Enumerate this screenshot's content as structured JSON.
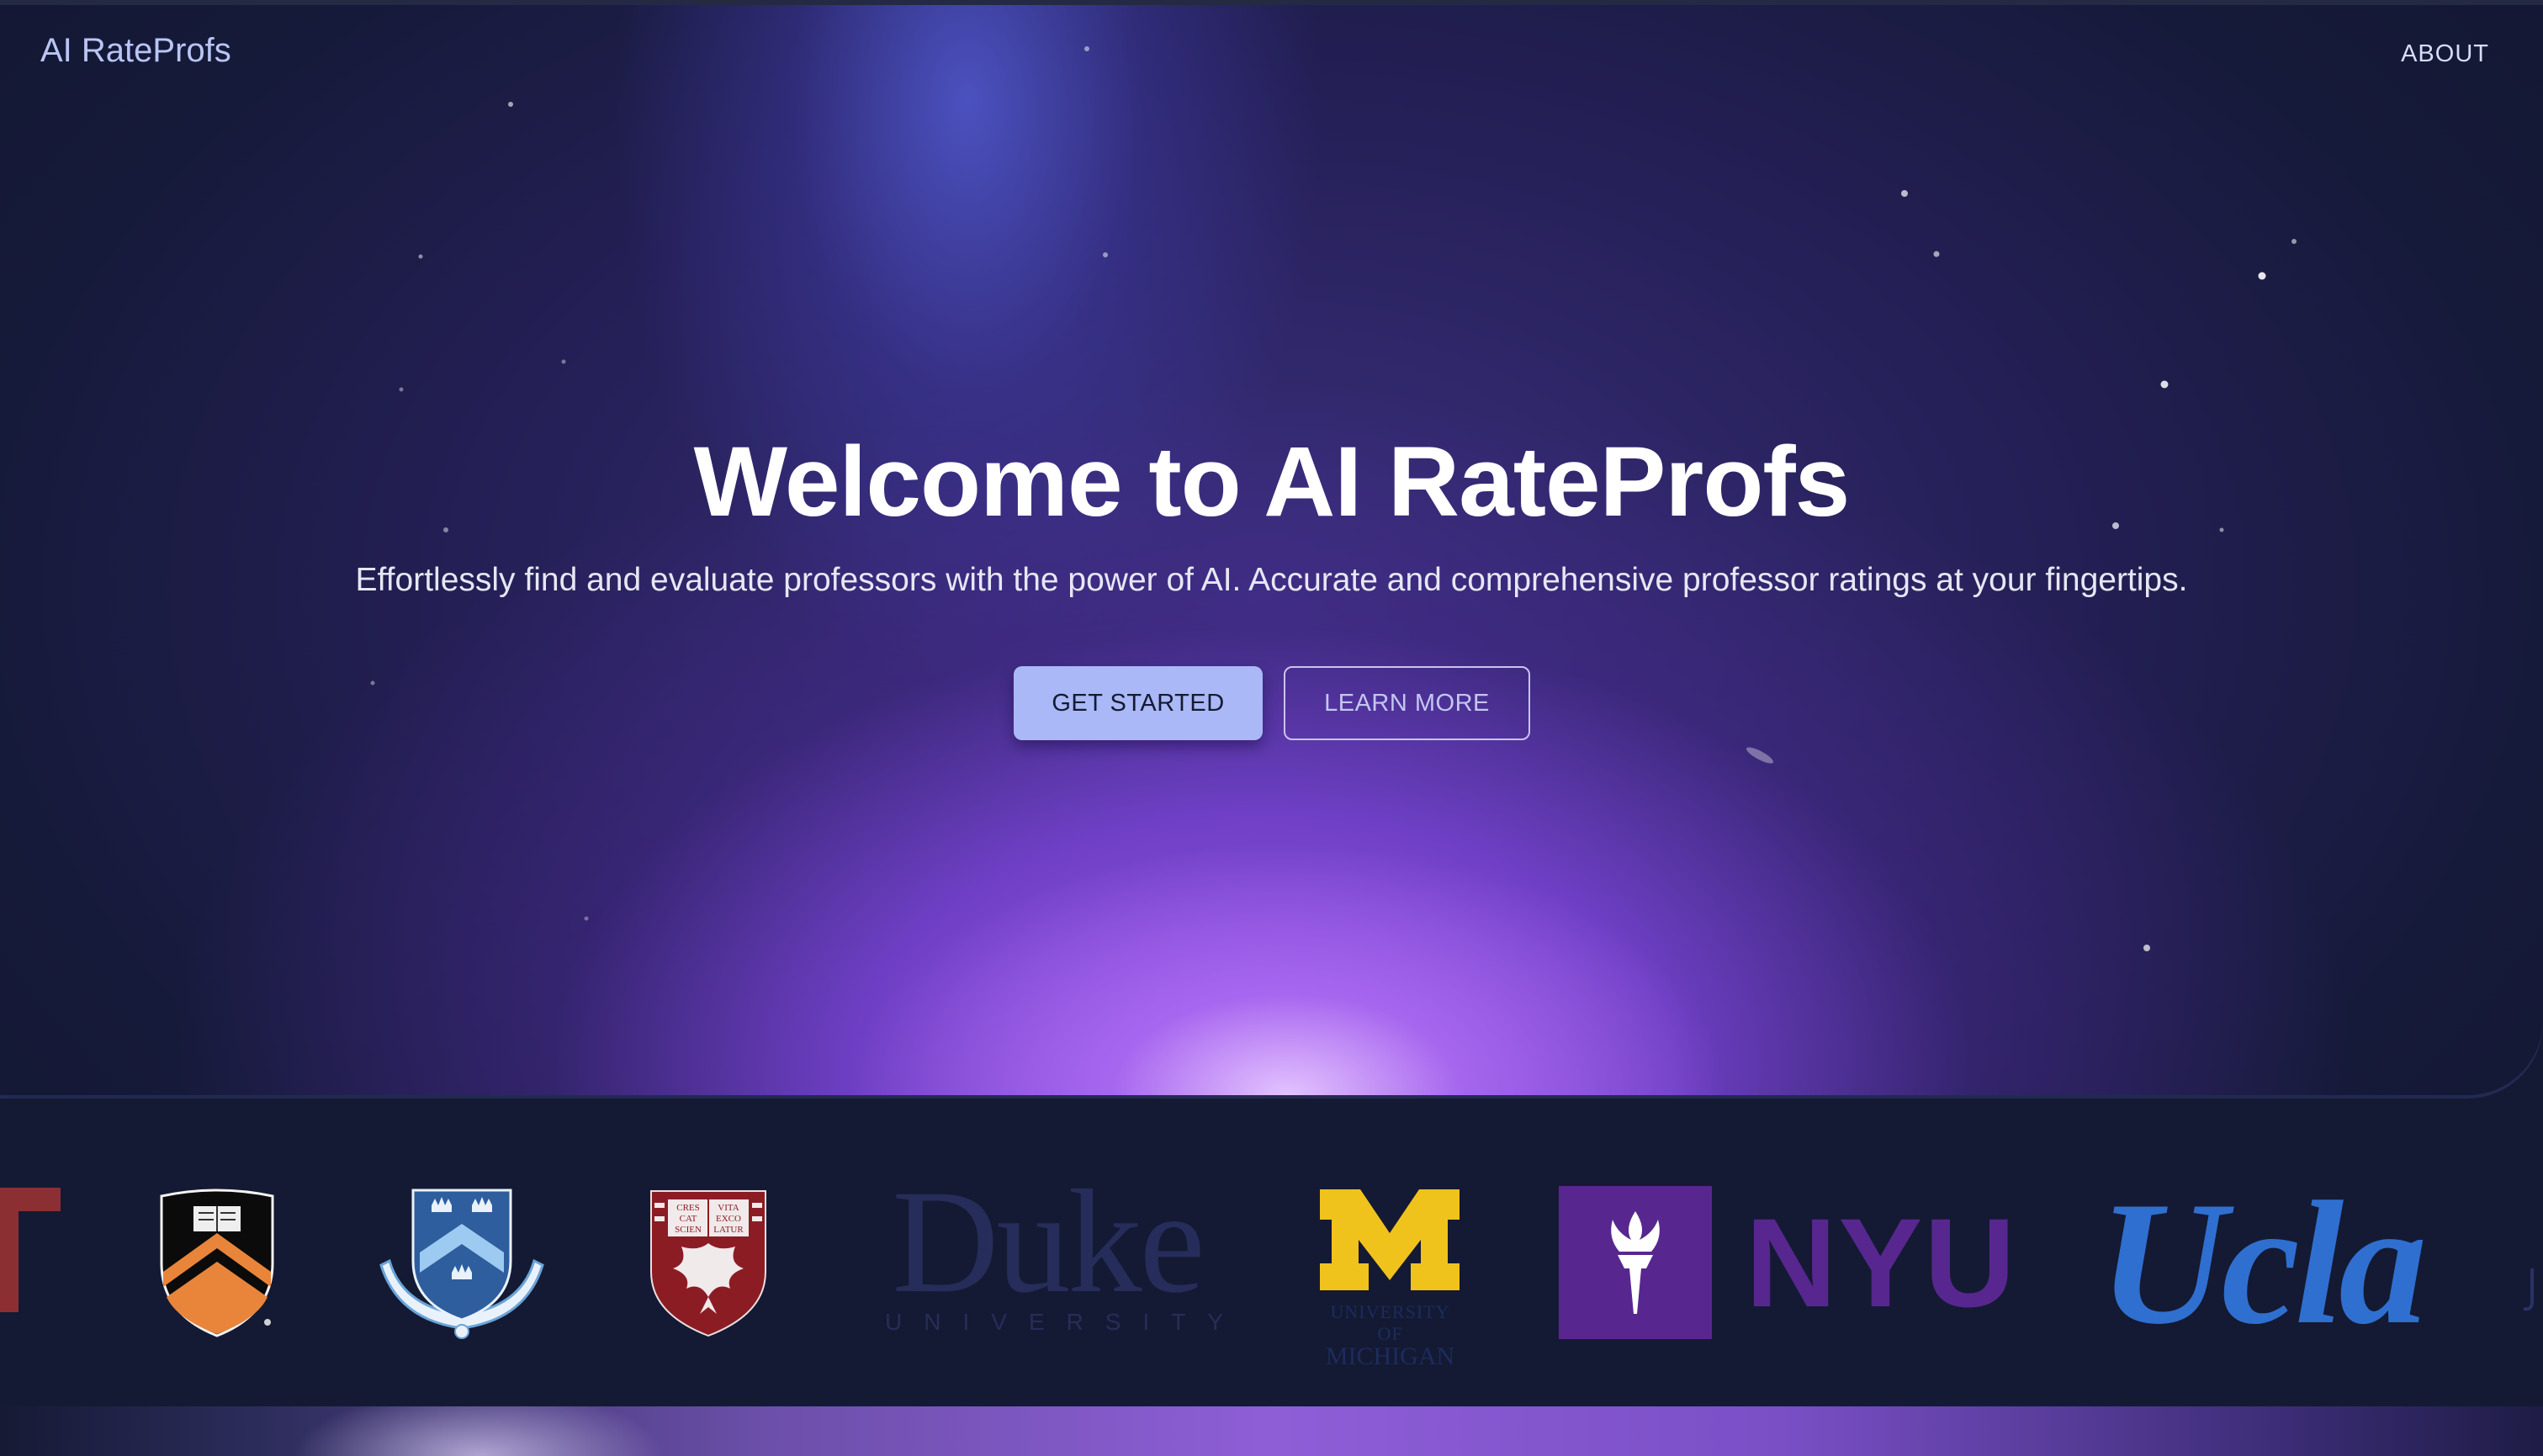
{
  "header": {
    "brand": "AI RateProfs",
    "nav_about": "ABOUT"
  },
  "hero": {
    "title": "Welcome to AI RateProfs",
    "subtitle": "Effortlessly find and evaluate professors with the power of AI. Accurate and comprehensive professor ratings at your fingertips.",
    "primary_button": "GET STARTED",
    "secondary_button": "LEARN MORE"
  },
  "universities": {
    "duke": {
      "word": "Duke",
      "sub": "UNIVERSITY"
    },
    "michigan": {
      "letter": "M",
      "sub1": "UNIVERSITY OF",
      "sub2": "MICHIGAN"
    },
    "nyu": {
      "word": "NYU"
    },
    "ucla": {
      "word": "Ucla"
    },
    "chicago_motto": {
      "l1": "CRES",
      "l2": "CAT",
      "l3": "SCIEN",
      "r1": "VITA",
      "r2": "EXCO",
      "r3": "LATUR"
    }
  },
  "colors": {
    "background": "#141a33",
    "brand": "#b9c5f4",
    "primary_button": "#aab8f7",
    "michigan_maize": "#f0c21c",
    "nyu_violet": "#57278f",
    "ucla_blue": "#2f6fd0",
    "chicago_maroon": "#8c1c24",
    "princeton_orange": "#e8853b",
    "columbia_blue": "#9ccaf0"
  }
}
